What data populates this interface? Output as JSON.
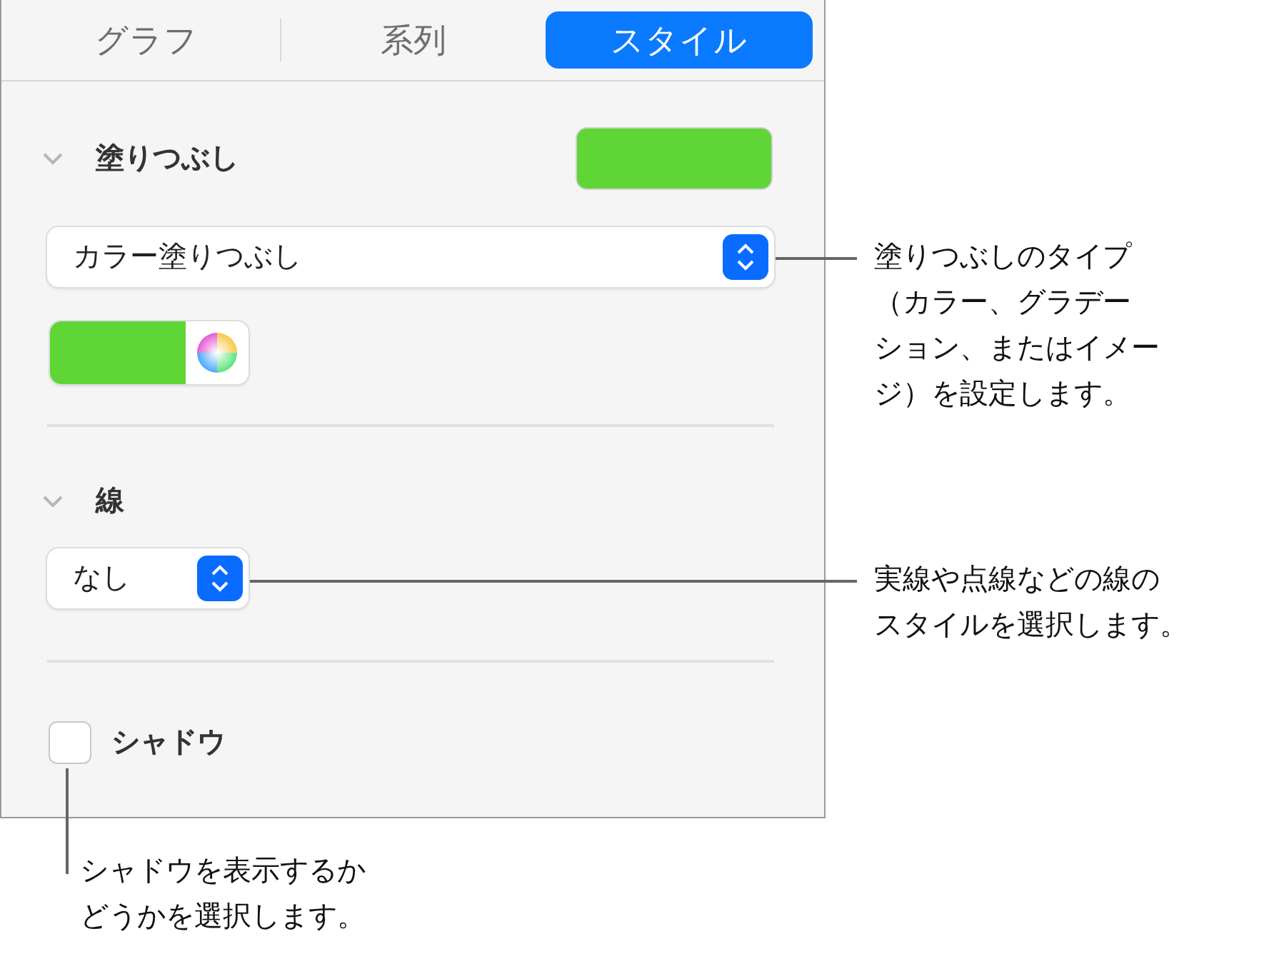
{
  "tabs": [
    {
      "label": "グラフ",
      "selected": false
    },
    {
      "label": "系列",
      "selected": false
    },
    {
      "label": "スタイル",
      "selected": true
    }
  ],
  "fill": {
    "title": "塗りつぶし",
    "expanded": true,
    "color": "#5fd636",
    "popup": {
      "value": "カラー塗りつぶし"
    }
  },
  "stroke": {
    "title": "線",
    "expanded": true,
    "popup": {
      "value": "なし"
    }
  },
  "shadow": {
    "label": "シャドウ",
    "checked": false
  },
  "callouts": [
    {
      "lines": [
        "塗りつぶしのタイプ",
        "（カラー、グラデー",
        "ション、またはイメー",
        "ジ）を設定します。"
      ]
    },
    {
      "lines": [
        "実線や点線などの線の",
        "スタイルを選択します。"
      ]
    },
    {
      "lines": [
        "シャドウを表示するか",
        "どうかを選択します。"
      ]
    }
  ]
}
